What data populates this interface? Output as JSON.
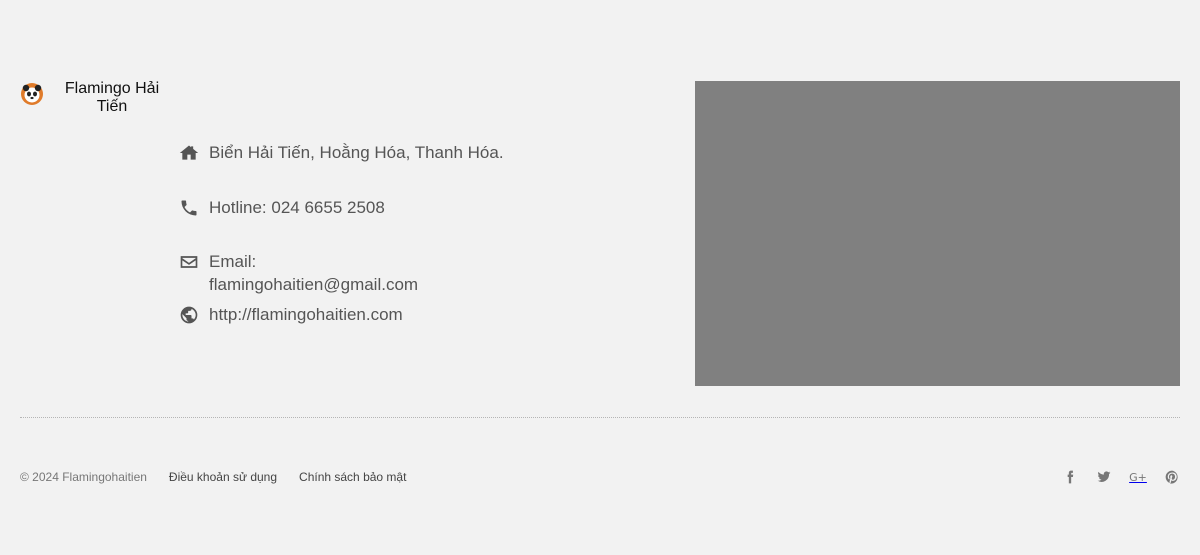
{
  "brand": {
    "name": "Flamingo Hải Tiến",
    "logo_icon": "panda-logo-icon"
  },
  "contact": {
    "address": "Biển Hải Tiến, Hoằng Hóa, Thanh Hóa.",
    "hotline": "Hotline: 024 6655 2508",
    "email": "Email: flamingohaitien@gmail.com",
    "website": "http://flamingohaitien.com",
    "icons": [
      "home-icon",
      "phone-icon",
      "envelope-icon",
      "globe-icon"
    ]
  },
  "map": {
    "color": "#808080"
  },
  "footer": {
    "copyright": "© 2024 Flamingohaitien",
    "links": [
      "Điều khoản sử dụng",
      "Chính sách bảo mật"
    ],
    "social": [
      "facebook-icon",
      "twitter-icon",
      "google-plus-icon",
      "pinterest-icon"
    ],
    "google_plus_text": "G+"
  }
}
